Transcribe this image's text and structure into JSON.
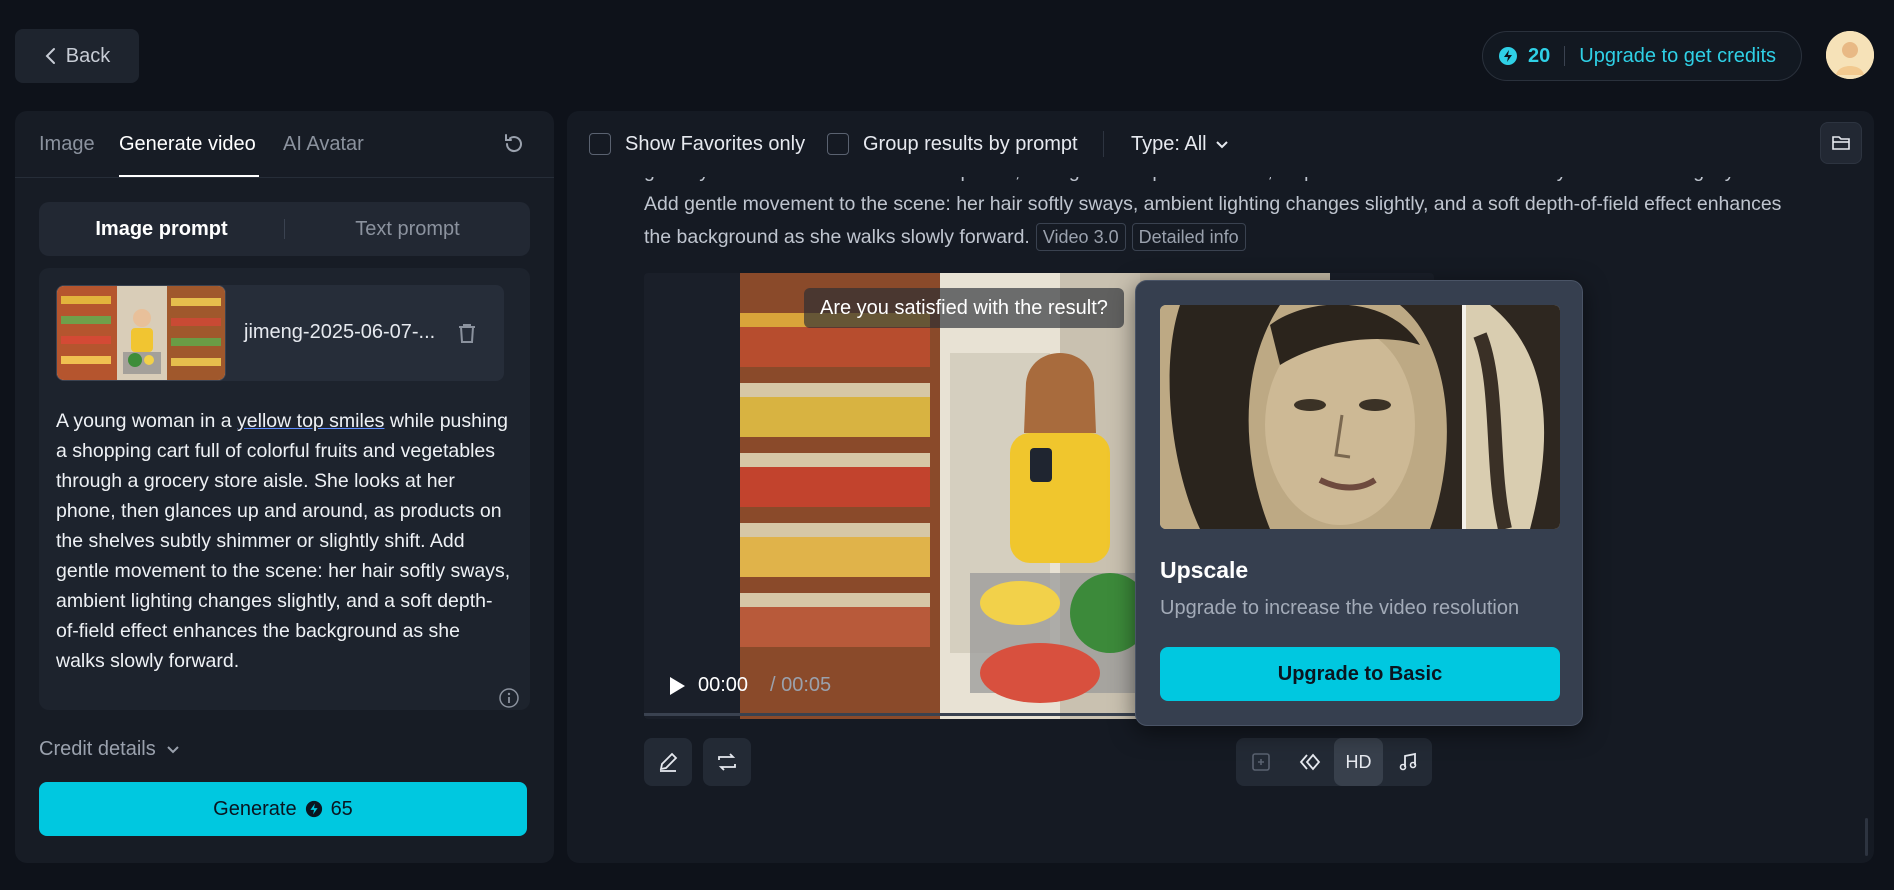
{
  "header": {
    "back_label": "Back",
    "credits": "20",
    "upgrade_label": "Upgrade to get credits"
  },
  "left_panel": {
    "tabs": [
      "Image",
      "Generate video",
      "AI Avatar"
    ],
    "active_tab": "Generate video",
    "prompt_modes": [
      "Image prompt",
      "Text prompt"
    ],
    "active_mode": "Image prompt",
    "file_name": "jimeng-2025-06-07-...",
    "prompt_parts": {
      "before": "A young woman in a ",
      "underlined": "yellow top smiles",
      "after": " while pushing a shopping cart full of colorful fruits and vegetables through a grocery store aisle. She looks at her phone, then glances up and around, as products on the shelves subtly shimmer or slightly shift. Add gentle movement to the scene: her hair softly sways, ambient lighting changes slightly, and a soft depth-of-field effect enhances the background as she walks slowly forward."
    },
    "credit_details_label": "Credit details",
    "generate_label": "Generate",
    "generate_cost": "65"
  },
  "filters": {
    "favorites_label": "Show Favorites only",
    "group_label": "Group results by prompt",
    "type_label": "Type: All"
  },
  "result": {
    "prompt_line1": "grocery store aisle. She looks at her phone, then glances up and around, as products on the shelves subtly shimmer or slightly shift.",
    "prompt_line2": "Add gentle movement to the scene: her hair softly sways, ambient lighting changes slightly, and a soft depth-of-field effect enhances",
    "prompt_line3": "the background as she walks slowly forward.",
    "tag_model": "Video 3.0",
    "tag_info": "Detailed info",
    "satisfied_text": "Are you satisfied with the result?",
    "time_current": "00:00",
    "time_total": " / 00:05",
    "progress": 0,
    "hd_label": "HD"
  },
  "popover": {
    "title": "Upscale",
    "description": "Upgrade to increase the video resolution",
    "button_label": "Upgrade to Basic"
  },
  "colors": {
    "accent": "#00c8e0",
    "accent_text": "#2fd0e6",
    "background": "#0e121a",
    "panel": "#171c25"
  }
}
